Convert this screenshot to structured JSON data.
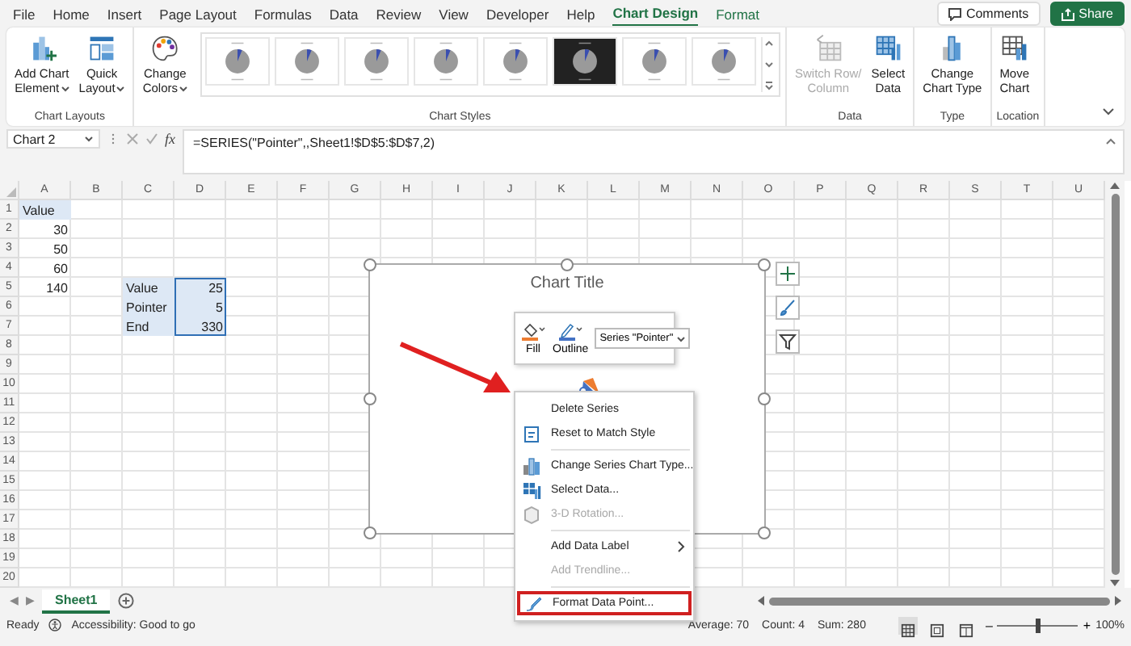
{
  "menu_bar": {
    "tabs": [
      {
        "label": "File",
        "selected": false,
        "kind": "normal"
      },
      {
        "label": "Home",
        "selected": false,
        "kind": "normal"
      },
      {
        "label": "Insert",
        "selected": false,
        "kind": "normal"
      },
      {
        "label": "Page Layout",
        "selected": false,
        "kind": "normal"
      },
      {
        "label": "Formulas",
        "selected": false,
        "kind": "normal"
      },
      {
        "label": "Data",
        "selected": false,
        "kind": "normal"
      },
      {
        "label": "Review",
        "selected": false,
        "kind": "normal"
      },
      {
        "label": "View",
        "selected": false,
        "kind": "normal"
      },
      {
        "label": "Developer",
        "selected": false,
        "kind": "normal"
      },
      {
        "label": "Help",
        "selected": false,
        "kind": "normal"
      },
      {
        "label": "Chart Design",
        "selected": true,
        "kind": "contextual"
      },
      {
        "label": "Format",
        "selected": false,
        "kind": "contextual"
      }
    ],
    "buttons": [
      {
        "label": "Comments",
        "kind": "comments"
      },
      {
        "label": "Share",
        "kind": "share"
      }
    ]
  },
  "ribbon": {
    "groups": [
      {
        "label": "Chart Layouts",
        "commands": [
          {
            "lines": [
              "Add Chart",
              "Element"
            ],
            "kind": "add_element",
            "dropdown": true,
            "disabled": false
          },
          {
            "lines": [
              "Quick",
              "Layout"
            ],
            "kind": "quick_layout",
            "dropdown": true,
            "disabled": false
          }
        ]
      },
      {
        "label": "Chart Styles",
        "commands": [
          {
            "lines": [
              "Change",
              "Colors"
            ],
            "kind": "change_colors",
            "dropdown": true,
            "disabled": false
          }
        ],
        "gallery": [
          {
            "kind": "light"
          },
          {
            "kind": "light"
          },
          {
            "kind": "light"
          },
          {
            "kind": "light"
          },
          {
            "kind": "light"
          },
          {
            "kind": "dark"
          },
          {
            "kind": "light"
          },
          {
            "kind": "light"
          }
        ]
      },
      {
        "label": "Data",
        "commands": [
          {
            "lines": [
              "Switch Row/",
              "Column"
            ],
            "kind": "switch_row_column",
            "dropdown": false,
            "disabled": true
          },
          {
            "lines": [
              "Select",
              "Data"
            ],
            "kind": "select_data",
            "dropdown": false,
            "disabled": false
          }
        ]
      },
      {
        "label": "Type",
        "commands": [
          {
            "lines": [
              "Change",
              "Chart Type"
            ],
            "kind": "change_chart_type",
            "dropdown": false,
            "disabled": false
          }
        ]
      },
      {
        "label": "Location",
        "commands": [
          {
            "lines": [
              "Move",
              "Chart"
            ],
            "kind": "move_chart",
            "dropdown": false,
            "disabled": false
          }
        ]
      }
    ]
  },
  "formula_bar": {
    "name_box": "Chart 2",
    "function_button": "fx",
    "formula": "=SERIES(\"Pointer\",,Sheet1!$D$5:$D$7,2)"
  },
  "sheet": {
    "columns": [
      "A",
      "B",
      "C",
      "D",
      "E",
      "F",
      "G",
      "H",
      "I",
      "J",
      "K",
      "L",
      "M",
      "N",
      "O",
      "P",
      "Q",
      "R",
      "S",
      "T",
      "U"
    ],
    "rows": [
      {
        "label": "1",
        "cells": [
          {
            "text": "Value",
            "kind": "text",
            "highlighted": true,
            "selected": false
          }
        ]
      },
      {
        "label": "2",
        "cells": [
          {
            "text": "30",
            "kind": "number",
            "highlighted": false,
            "selected": false
          }
        ]
      },
      {
        "label": "3",
        "cells": [
          {
            "text": "50",
            "kind": "number",
            "highlighted": false,
            "selected": false
          }
        ]
      },
      {
        "label": "4",
        "cells": [
          {
            "text": "60",
            "kind": "number",
            "highlighted": false,
            "selected": false
          }
        ]
      },
      {
        "label": "5",
        "cells": [
          {
            "text": "140",
            "kind": "number",
            "highlighted": false,
            "selected": false
          },
          {},
          {
            "text": "Value",
            "kind": "text",
            "highlighted": true,
            "selected": false
          },
          {
            "text": "25",
            "kind": "number",
            "highlighted": true,
            "selected": true
          }
        ]
      },
      {
        "label": "6",
        "cells": [
          {},
          {},
          {
            "text": "Pointer",
            "kind": "text",
            "highlighted": true,
            "selected": false
          },
          {
            "text": "5",
            "kind": "number",
            "highlighted": true,
            "selected": true
          }
        ]
      },
      {
        "label": "7",
        "cells": [
          {},
          {},
          {
            "text": "End",
            "kind": "text",
            "highlighted": true,
            "selected": false
          },
          {
            "text": "330",
            "kind": "number",
            "highlighted": true,
            "selected": true
          }
        ]
      },
      {
        "label": "8"
      },
      {
        "label": "9"
      },
      {
        "label": "10"
      },
      {
        "label": "11"
      },
      {
        "label": "12"
      },
      {
        "label": "13"
      },
      {
        "label": "14"
      },
      {
        "label": "15"
      },
      {
        "label": "16"
      },
      {
        "label": "17"
      },
      {
        "label": "18"
      },
      {
        "label": "19"
      },
      {
        "label": "20"
      }
    ]
  },
  "chart": {
    "title": "Chart Title",
    "side_buttons": [
      {
        "kind": "add"
      },
      {
        "kind": "style"
      },
      {
        "kind": "filter"
      }
    ]
  },
  "mini_toolbar": {
    "buttons": [
      {
        "label": "Fill",
        "kind": "fill"
      },
      {
        "label": "Outline",
        "kind": "outline"
      }
    ],
    "series_picker": "Series \"Pointer\""
  },
  "context_menu": {
    "groups": [
      [
        {
          "label": "Delete Series",
          "kind": "plain",
          "disabled": false,
          "submenu": false,
          "annotated": false
        },
        {
          "label": "Reset to Match Style",
          "kind": "reset",
          "disabled": false,
          "submenu": false,
          "annotated": false
        }
      ],
      [
        {
          "label": "Change Series Chart Type...",
          "kind": "chart_type",
          "disabled": false,
          "submenu": false,
          "annotated": false
        },
        {
          "label": "Select Data...",
          "kind": "select_data",
          "disabled": false,
          "submenu": false,
          "annotated": false
        },
        {
          "label": "3-D Rotation...",
          "kind": "rotation",
          "disabled": true,
          "submenu": false,
          "annotated": false
        }
      ],
      [
        {
          "label": "Add Data Label",
          "kind": "plain",
          "disabled": false,
          "submenu": true,
          "annotated": false
        },
        {
          "label": "Add Trendline...",
          "kind": "plain",
          "disabled": true,
          "submenu": false,
          "annotated": false
        }
      ],
      [
        {
          "label": "Format Data Point...",
          "kind": "format",
          "disabled": false,
          "submenu": false,
          "annotated": true
        }
      ]
    ]
  },
  "arrow_annotation": true,
  "sheet_tabs": {
    "nav": [
      "◀",
      "▶"
    ],
    "tabs": [
      {
        "label": "Sheet1",
        "selected": true
      }
    ]
  },
  "status_bar": {
    "mode": "Ready",
    "accessibility": "Accessibility: Good to go",
    "stats": [
      "Average: 70",
      "Count: 4",
      "Sum: 280"
    ],
    "views": [
      {
        "kind": "normal",
        "selected": true
      },
      {
        "kind": "page_layout",
        "selected": false
      },
      {
        "kind": "page_break",
        "selected": false
      }
    ],
    "zoom": {
      "minus": "–",
      "plus": "+",
      "level": 0.5,
      "reading": "100%"
    }
  }
}
